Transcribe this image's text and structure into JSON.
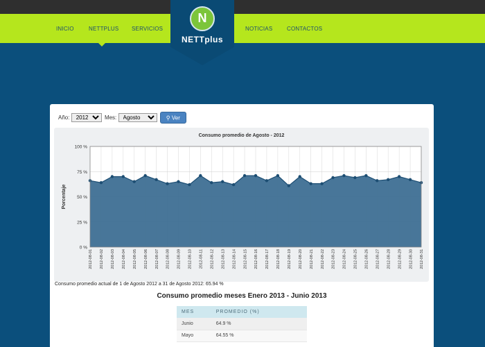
{
  "nav": {
    "items": [
      "INICIO",
      "NETTPLUS",
      "SERVICIOS",
      "NOTICIAS",
      "CONTACTOS"
    ]
  },
  "logo": {
    "mark": "N",
    "text": "NETTplus"
  },
  "filters": {
    "year_label": "Año:",
    "year_value": "2012",
    "month_label": "Mes:",
    "month_value": "Agosto",
    "button_label": "Ver"
  },
  "chart_data": {
    "type": "area",
    "title": "Consumo promedio de Agosto - 2012",
    "xlabel": "",
    "ylabel": "Porcentaje",
    "ylim": [
      0,
      100
    ],
    "yticks": [
      "0 %",
      "25 %",
      "50 %",
      "75 %",
      "100 %"
    ],
    "grid": true,
    "categories": [
      "2012-08-01",
      "2012-08-02",
      "2012-08-03",
      "2012-08-04",
      "2012-08-05",
      "2012-08-06",
      "2012-08-07",
      "2012-08-08",
      "2012-08-09",
      "2012-08-10",
      "2012-08-11",
      "2012-08-12",
      "2012-08-13",
      "2012-08-14",
      "2012-08-15",
      "2012-08-16",
      "2012-08-17",
      "2012-08-18",
      "2012-08-19",
      "2012-08-20",
      "2012-08-21",
      "2012-08-22",
      "2012-08-23",
      "2012-08-24",
      "2012-08-25",
      "2012-08-26",
      "2012-08-27",
      "2012-08-28",
      "2012-08-29",
      "2012-08-30",
      "2012-08-31"
    ],
    "values": [
      66,
      64,
      70,
      70,
      65,
      71,
      67,
      63,
      65,
      62,
      71,
      64,
      65,
      62,
      71,
      71,
      66,
      71,
      61,
      70,
      63,
      63,
      69,
      71,
      69,
      71,
      66,
      67,
      70,
      67,
      64
    ],
    "colors": {
      "fill": "#3e6f94",
      "line": "#1d4e73"
    }
  },
  "actual_text": "Consumo promedio actual de 1 de Agosto 2012 a 31 de Agosto 2012: 65.94 %",
  "monthly": {
    "title": "Consumo promedio meses Enero 2013 - Junio 2013",
    "headers": [
      "MES",
      "PROMEDIO (%)"
    ],
    "rows": [
      [
        "Junio",
        "64.9 %"
      ],
      [
        "Mayo",
        "64.55 %"
      ]
    ]
  }
}
